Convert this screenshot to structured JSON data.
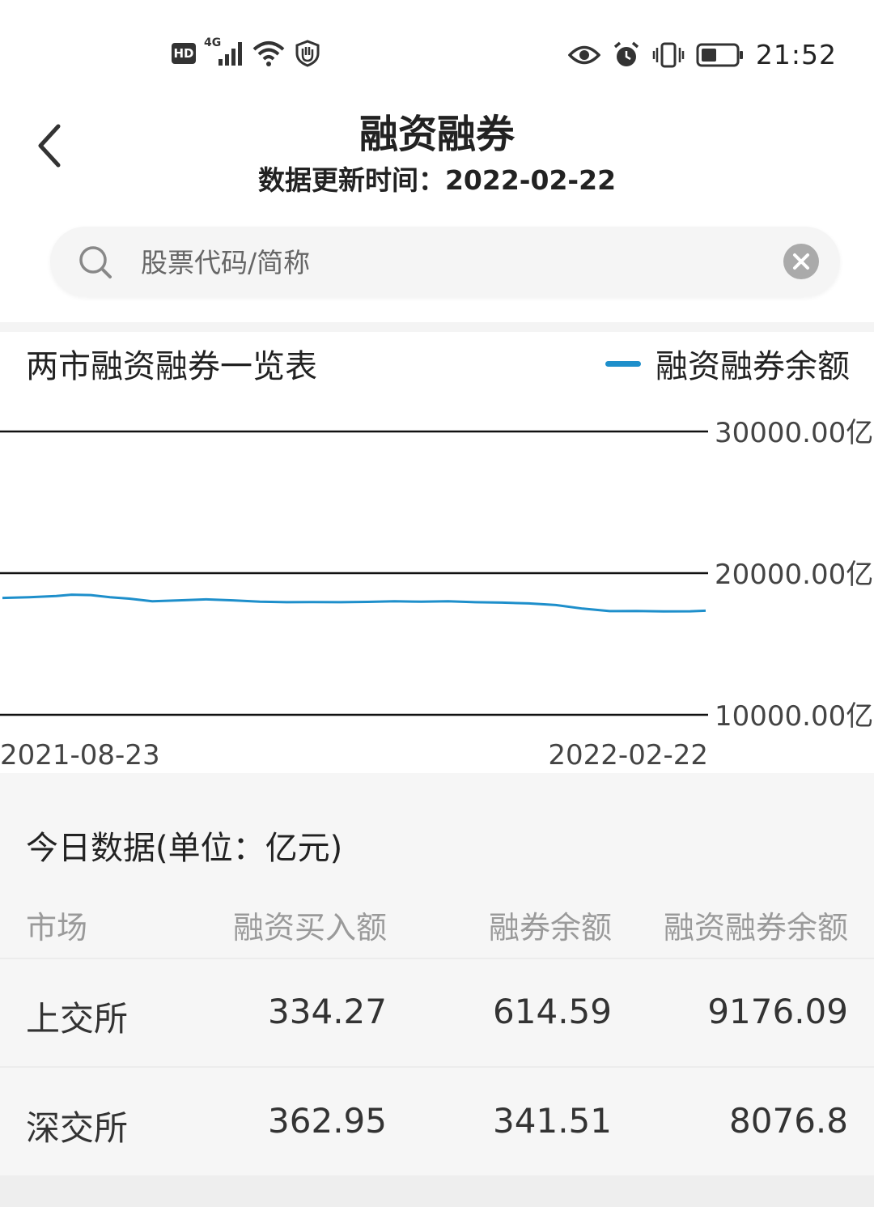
{
  "status_bar": {
    "time": "21:52",
    "left_icons": [
      "hd-icon",
      "signal-4g-icon",
      "wifi-icon",
      "hand-icon"
    ],
    "right_icons": [
      "eye-icon",
      "alarm-icon",
      "vibrate-icon",
      "battery-icon"
    ],
    "network_label": "4G",
    "hd_label": "HD"
  },
  "header": {
    "title": "融资融券",
    "subtitle": "数据更新时间：2022-02-22"
  },
  "search": {
    "placeholder": "股票代码/简称",
    "value": ""
  },
  "chart_section": {
    "title": "两市融资融券一览表",
    "legend_label": "融资融券余额",
    "line_color": "#1e8fcb"
  },
  "chart_data": {
    "type": "line",
    "x_start": "2021-08-23",
    "x_end": "2022-02-22",
    "yticks": [
      "30000.00亿",
      "20000.00亿",
      "10000.00亿"
    ],
    "ylim": [
      10000,
      30000
    ],
    "grid": true,
    "legend_position": "top-right",
    "series": [
      {
        "name": "融资融券余额",
        "color": "#1e8fcb",
        "x": [
          "2021-08-23",
          "2021-08-30",
          "2021-09-06",
          "2021-09-10",
          "2021-09-15",
          "2021-09-20",
          "2021-09-25",
          "2021-10-01",
          "2021-10-08",
          "2021-10-15",
          "2021-10-22",
          "2021-10-29",
          "2021-11-05",
          "2021-11-12",
          "2021-11-19",
          "2021-11-26",
          "2021-12-03",
          "2021-12-10",
          "2021-12-17",
          "2021-12-24",
          "2021-12-31",
          "2022-01-07",
          "2022-01-14",
          "2022-01-21",
          "2022-01-28",
          "2022-02-04",
          "2022-02-11",
          "2022-02-18",
          "2022-02-22"
        ],
        "values": [
          18250,
          18300,
          18380,
          18480,
          18450,
          18300,
          18200,
          18020,
          18080,
          18150,
          18080,
          17980,
          17950,
          17960,
          17950,
          17970,
          18020,
          17980,
          18010,
          17950,
          17920,
          17860,
          17750,
          17500,
          17320,
          17330,
          17300,
          17310,
          17350
        ]
      }
    ]
  },
  "today_table": {
    "title": "今日数据(单位：亿元)",
    "columns": [
      "市场",
      "融资买入额",
      "融券余额",
      "融资融券余额"
    ],
    "rows": [
      [
        "上交所",
        "334.27",
        "614.59",
        "9176.09"
      ],
      [
        "深交所",
        "362.95",
        "341.51",
        "8076.8"
      ]
    ]
  }
}
